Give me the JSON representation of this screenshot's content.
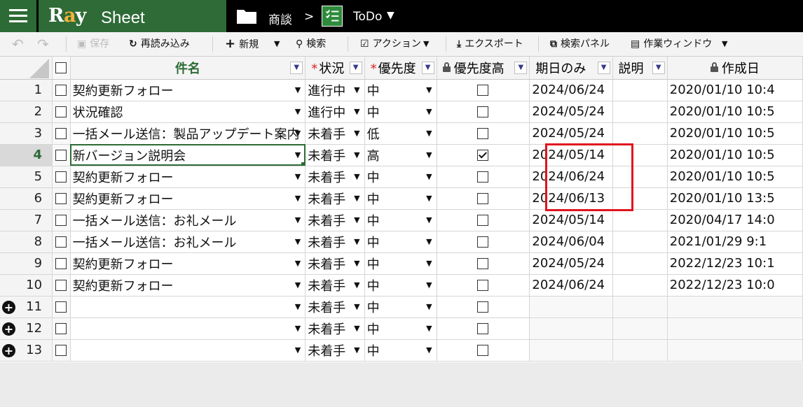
{
  "brand": {
    "ray": "Ray",
    "sheet": "Sheet"
  },
  "breadcrumb": {
    "folder": "商談",
    "separator": ">",
    "current": "ToDo",
    "caret": "▼"
  },
  "toolbar": {
    "undo": "↶",
    "redo": "↷",
    "save": "保存",
    "reload": "再読み込み",
    "new": "新規",
    "new_caret": "▼",
    "search": "検索",
    "action": "アクション",
    "action_caret": "▼",
    "export": "エクスポート",
    "search_panel": "検索パネル",
    "work_window": "作業ウィンドウ",
    "work_caret": "▼"
  },
  "columns": {
    "name": "件名",
    "status": "状況",
    "priority": "優先度",
    "priority_high": "優先度高",
    "due": "期日のみ",
    "desc": "説明",
    "created": "作成日",
    "required_mark": "*",
    "dd": "▼"
  },
  "rows": [
    {
      "no": "1",
      "name": "契約更新フォロー",
      "status": "進行中",
      "priority": "中",
      "high": false,
      "due": "2024/06/24",
      "created": "2020/01/10 10:4"
    },
    {
      "no": "2",
      "name": "状況確認",
      "status": "進行中",
      "priority": "中",
      "high": false,
      "due": "2024/05/24",
      "created": "2020/01/10 10:5"
    },
    {
      "no": "3",
      "name": "一括メール送信：製品アップデート案内",
      "status": "未着手",
      "priority": "低",
      "high": false,
      "due": "2024/05/24",
      "created": "2020/01/10 10:5"
    },
    {
      "no": "4",
      "name": "新バージョン説明会",
      "status": "未着手",
      "priority": "高",
      "high": true,
      "due": "2024/05/14",
      "created": "2020/01/10 10:5"
    },
    {
      "no": "5",
      "name": "契約更新フォロー",
      "status": "未着手",
      "priority": "中",
      "high": false,
      "due": "2024/06/24",
      "created": "2020/01/10 10:5"
    },
    {
      "no": "6",
      "name": "契約更新フォロー",
      "status": "未着手",
      "priority": "中",
      "high": false,
      "due": "2024/06/13",
      "created": "2020/01/10 13:5"
    },
    {
      "no": "7",
      "name": "一括メール送信：お礼メール",
      "status": "未着手",
      "priority": "中",
      "high": false,
      "due": "2024/05/14",
      "created": "2020/04/17 14:0"
    },
    {
      "no": "8",
      "name": "一括メール送信：お礼メール",
      "status": "未着手",
      "priority": "中",
      "high": false,
      "due": "2024/06/04",
      "created": " 2021/01/29 9:1"
    },
    {
      "no": "9",
      "name": "契約更新フォロー",
      "status": "未着手",
      "priority": "中",
      "high": false,
      "due": "2024/05/24",
      "created": "2022/12/23 10:1"
    },
    {
      "no": "10",
      "name": "契約更新フォロー",
      "status": "未着手",
      "priority": "中",
      "high": false,
      "due": "2024/06/24",
      "created": "2022/12/23 10:0"
    },
    {
      "no": "11",
      "name": "",
      "status": "未着手",
      "priority": "中",
      "high": false,
      "due": "",
      "created": "",
      "new": true
    },
    {
      "no": "12",
      "name": "",
      "status": "未着手",
      "priority": "中",
      "high": false,
      "due": "",
      "created": "",
      "new": true
    },
    {
      "no": "13",
      "name": "",
      "status": "未着手",
      "priority": "中",
      "high": false,
      "due": "",
      "created": "",
      "new": true
    }
  ],
  "active_row": "4",
  "colors": {
    "brand_green": "#2e6b37",
    "highlight": "#e0141e"
  }
}
